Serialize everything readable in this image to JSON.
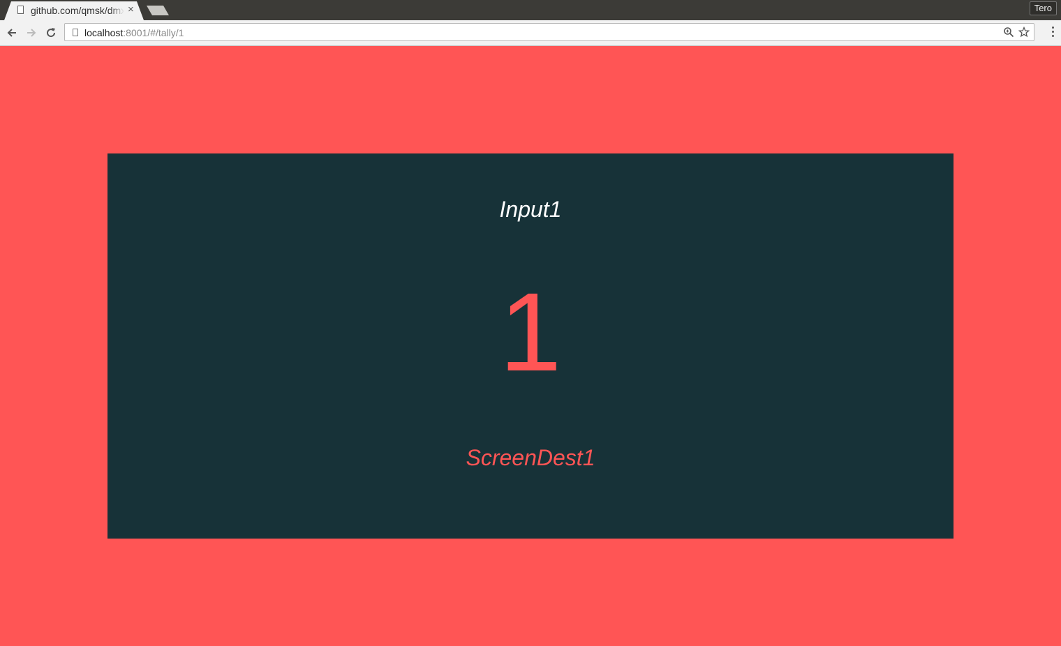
{
  "browser": {
    "tab": {
      "title": "github.com/qmsk/dmxcontrol",
      "close_glyph": "×"
    },
    "profile_name": "Tero",
    "address": {
      "host": "localhost",
      "rest": ":8001/#/tally/1"
    },
    "icons": {
      "back": "arrow-left-icon",
      "forward": "arrow-right-icon",
      "reload": "reload-icon",
      "zoom": "zoom-icon",
      "bookmark": "star-icon",
      "menu": "vertical-dots-icon",
      "page": "page-icon"
    }
  },
  "page": {
    "background_color": "#ff5555",
    "panel_color": "#173238",
    "tally": {
      "input": "Input1",
      "number": "1",
      "destination": "ScreenDest1"
    }
  }
}
